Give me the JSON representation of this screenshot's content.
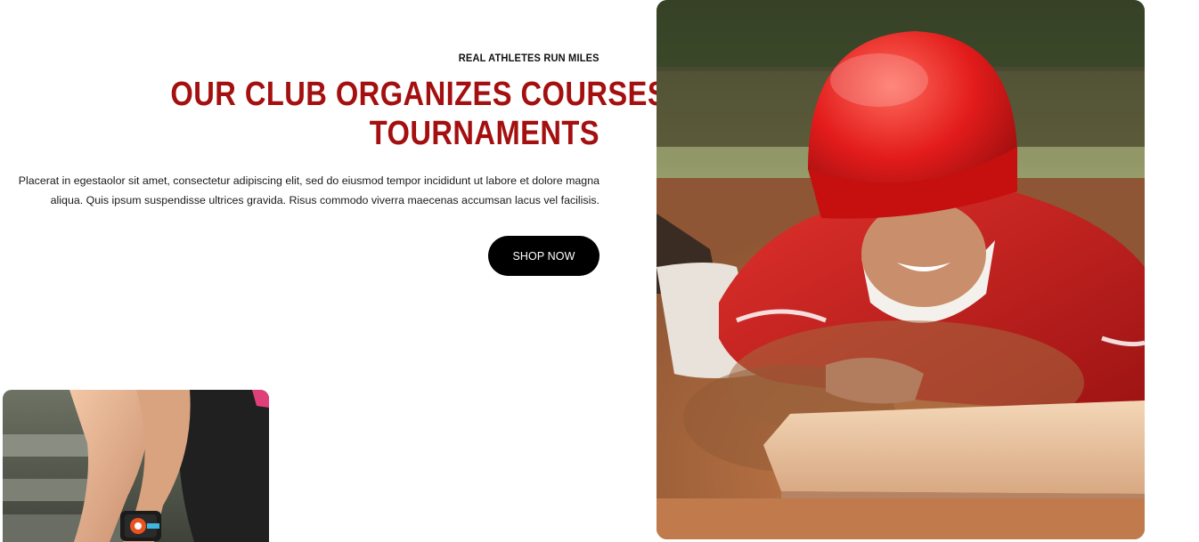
{
  "promo": {
    "eyebrow": "REAL ATHLETES RUN MILES",
    "headline_line1": "OUR CLUB ORGANIZES COURSES &",
    "headline_line2": "TOURNAMENTS",
    "body": "Placerat in egestaolor sit amet, consectetur adipiscing elit, sed do eiusmod tempor incididunt ut labore et dolore magna aliqua. Quis ipsum suspendisse ultrices gravida. Risus commodo viverra maecenas accumsan lacus vel facilisis.",
    "cta_label": "SHOP NOW"
  },
  "colors": {
    "headline": "#a40f0f",
    "button_bg": "#000000",
    "button_text": "#ffffff"
  },
  "images": {
    "hero": "baseball-player-sliding-photo",
    "secondary": "athlete-smartwatch-photo"
  }
}
